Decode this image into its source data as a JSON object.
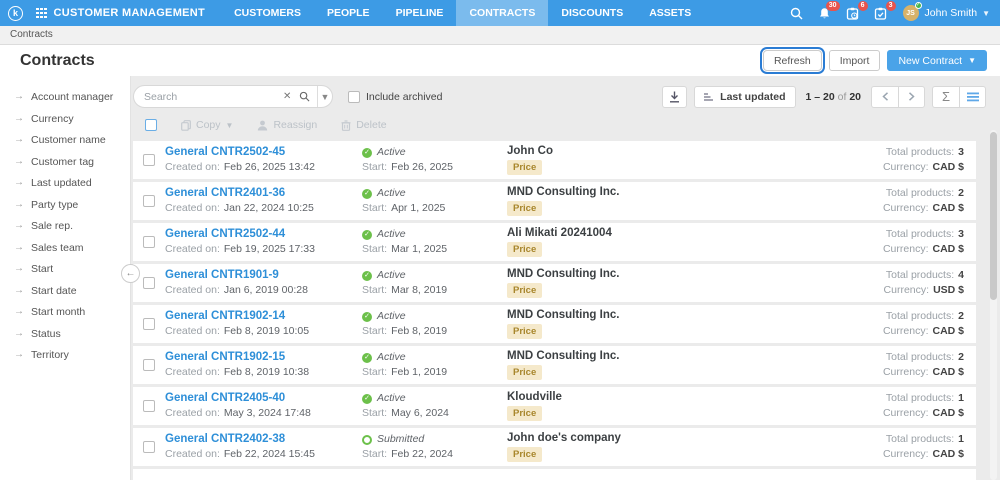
{
  "topnav": {
    "logo_letter": "k",
    "app_title": "CUSTOMER MANAGEMENT",
    "menu": [
      {
        "label": "CUSTOMERS",
        "active": false
      },
      {
        "label": "PEOPLE",
        "active": false
      },
      {
        "label": "PIPELINE",
        "active": false
      },
      {
        "label": "CONTRACTS",
        "active": true
      },
      {
        "label": "DISCOUNTS",
        "active": false
      },
      {
        "label": "ASSETS",
        "active": false
      }
    ],
    "badges": {
      "notifications": "30",
      "tasks": "6",
      "approvals": "3"
    },
    "user": {
      "initials": "JS",
      "name": "John Smith"
    }
  },
  "breadcrumb": {
    "current": "Contracts"
  },
  "header": {
    "title": "Contracts",
    "refresh_label": "Refresh",
    "import_label": "Import",
    "new_contract_label": "New Contract"
  },
  "sidebar": {
    "items": [
      {
        "label": "Account manager"
      },
      {
        "label": "Currency"
      },
      {
        "label": "Customer name"
      },
      {
        "label": "Customer tag"
      },
      {
        "label": "Last updated"
      },
      {
        "label": "Party type"
      },
      {
        "label": "Sale rep."
      },
      {
        "label": "Sales team"
      },
      {
        "label": "Start"
      },
      {
        "label": "Start date"
      },
      {
        "label": "Start month"
      },
      {
        "label": "Status"
      },
      {
        "label": "Territory"
      }
    ]
  },
  "controls": {
    "search_placeholder": "Search",
    "include_archived_label": "Include archived",
    "sort_label": "Last updated",
    "pagination": {
      "range": "1 – 20",
      "of_word": "of",
      "total": "20"
    }
  },
  "actions": {
    "copy_label": "Copy",
    "reassign_label": "Reassign",
    "delete_label": "Delete"
  },
  "row_labels": {
    "created_on": "Created on:",
    "start": "Start:",
    "total_products": "Total products:",
    "currency": "Currency:",
    "price_tag": "Price"
  },
  "rows": [
    {
      "name": "General CNTR2502-45",
      "created": "Feb 26, 2025 13:42",
      "status": "Active",
      "start": "Feb 26, 2025",
      "company": "John Co",
      "total_products": "3",
      "currency": "CAD $"
    },
    {
      "name": "General CNTR2401-36",
      "created": "Jan 22, 2024 10:25",
      "status": "Active",
      "start": "Apr 1, 2025",
      "company": "MND Consulting Inc.",
      "total_products": "2",
      "currency": "CAD $"
    },
    {
      "name": "General CNTR2502-44",
      "created": "Feb 19, 2025 17:33",
      "status": "Active",
      "start": "Mar 1, 2025",
      "company": "Ali Mikati 20241004",
      "total_products": "3",
      "currency": "CAD $"
    },
    {
      "name": "General CNTR1901-9",
      "created": "Jan 6, 2019 00:28",
      "status": "Active",
      "start": "Mar 8, 2019",
      "company": "MND Consulting Inc.",
      "total_products": "4",
      "currency": "USD $"
    },
    {
      "name": "General CNTR1902-14",
      "created": "Feb 8, 2019 10:05",
      "status": "Active",
      "start": "Feb 8, 2019",
      "company": "MND Consulting Inc.",
      "total_products": "2",
      "currency": "CAD $"
    },
    {
      "name": "General CNTR1902-15",
      "created": "Feb 8, 2019 10:38",
      "status": "Active",
      "start": "Feb 1, 2019",
      "company": "MND Consulting Inc.",
      "total_products": "2",
      "currency": "CAD $"
    },
    {
      "name": "General CNTR2405-40",
      "created": "May 3, 2024 17:48",
      "status": "Active",
      "start": "May 6, 2024",
      "company": "Kloudville",
      "total_products": "1",
      "currency": "CAD $"
    },
    {
      "name": "General CNTR2402-38",
      "created": "Feb 22, 2024 15:45",
      "status": "Submitted",
      "submitted": true,
      "start": "Feb 22, 2024",
      "company": "John doe's company",
      "total_products": "1",
      "currency": "CAD $"
    }
  ],
  "colors": {
    "nav_blue": "#3d9be5",
    "nav_active_tab": "#7fbcee",
    "link_blue": "#2e8fd8",
    "primary_button": "#4aa3e8",
    "status_green": "#6cc04a",
    "badge_red": "#e8544d",
    "price_badge_bg": "#f5e9cb",
    "price_badge_text": "#a8862c",
    "focus_ring": "#2a7cd4",
    "avatar_bg": "#d7b269"
  }
}
